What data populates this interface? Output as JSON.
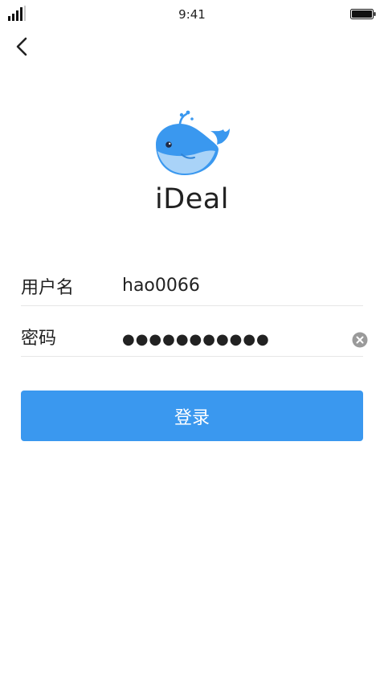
{
  "status_bar": {
    "time": "9:41",
    "signal_icon": "cellular-signal-icon",
    "battery_icon": "battery-icon"
  },
  "nav": {
    "back_icon": "chevron-left-icon"
  },
  "brand": {
    "logo_icon": "whale-logo-icon",
    "app_name": "iDeal",
    "color": "#3a98ef"
  },
  "form": {
    "username": {
      "label": "用户名",
      "value": "hao0066"
    },
    "password": {
      "label": "密码",
      "value": "●●●●●●●●●●●",
      "clear_icon": "clear-circle-icon"
    }
  },
  "actions": {
    "login_label": "登录",
    "login_color": "#3a98ef"
  }
}
